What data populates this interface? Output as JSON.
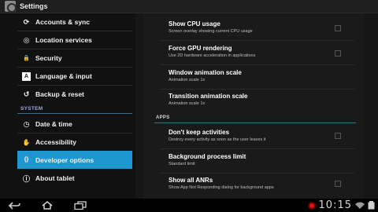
{
  "app": {
    "title": "Settings"
  },
  "sidebar": {
    "items": [
      {
        "label": "Accounts & sync",
        "icon": "sync-icon",
        "glyph": "⟳"
      },
      {
        "label": "Location services",
        "icon": "location-icon",
        "glyph": "◎"
      },
      {
        "label": "Security",
        "icon": "lock-icon",
        "glyph": "🔒"
      },
      {
        "label": "Language & input",
        "icon": "language-icon",
        "glyph": "A"
      },
      {
        "label": "Backup & reset",
        "icon": "backup-icon",
        "glyph": "↺"
      }
    ],
    "section_system": "SYSTEM",
    "system_items": [
      {
        "label": "Date & time",
        "icon": "clock-icon",
        "glyph": "◷"
      },
      {
        "label": "Accessibility",
        "icon": "hand-icon",
        "glyph": "✋"
      },
      {
        "label": "Developer options",
        "icon": "braces-icon",
        "glyph": "{}",
        "selected": true
      },
      {
        "label": "About tablet",
        "icon": "info-icon",
        "glyph": "ⓘ"
      }
    ]
  },
  "options": [
    {
      "title": "Show CPU usage",
      "subtitle": "Screen overlay showing current CPU usage",
      "checkbox": true
    },
    {
      "title": "Force GPU rendering",
      "subtitle": "Use 2D hardware acceleration in applications",
      "checkbox": true
    },
    {
      "title": "Window animation scale",
      "subtitle": "Animation scale 1x",
      "checkbox": false
    },
    {
      "title": "Transition animation scale",
      "subtitle": "Animation scale 1x",
      "checkbox": false
    }
  ],
  "apps_header": "APPS",
  "apps_options": [
    {
      "title": "Don't keep activities",
      "subtitle": "Destroy every activity as soon as the user leaves it",
      "checkbox": true
    },
    {
      "title": "Background process limit",
      "subtitle": "Standard limit",
      "checkbox": false
    },
    {
      "title": "Show all ANRs",
      "subtitle": "Show App Not Responding dialog for background apps",
      "checkbox": true
    }
  ],
  "status": {
    "time": "10:15"
  },
  "colors": {
    "accent": "#1e97d1",
    "record": "#dd1111"
  }
}
